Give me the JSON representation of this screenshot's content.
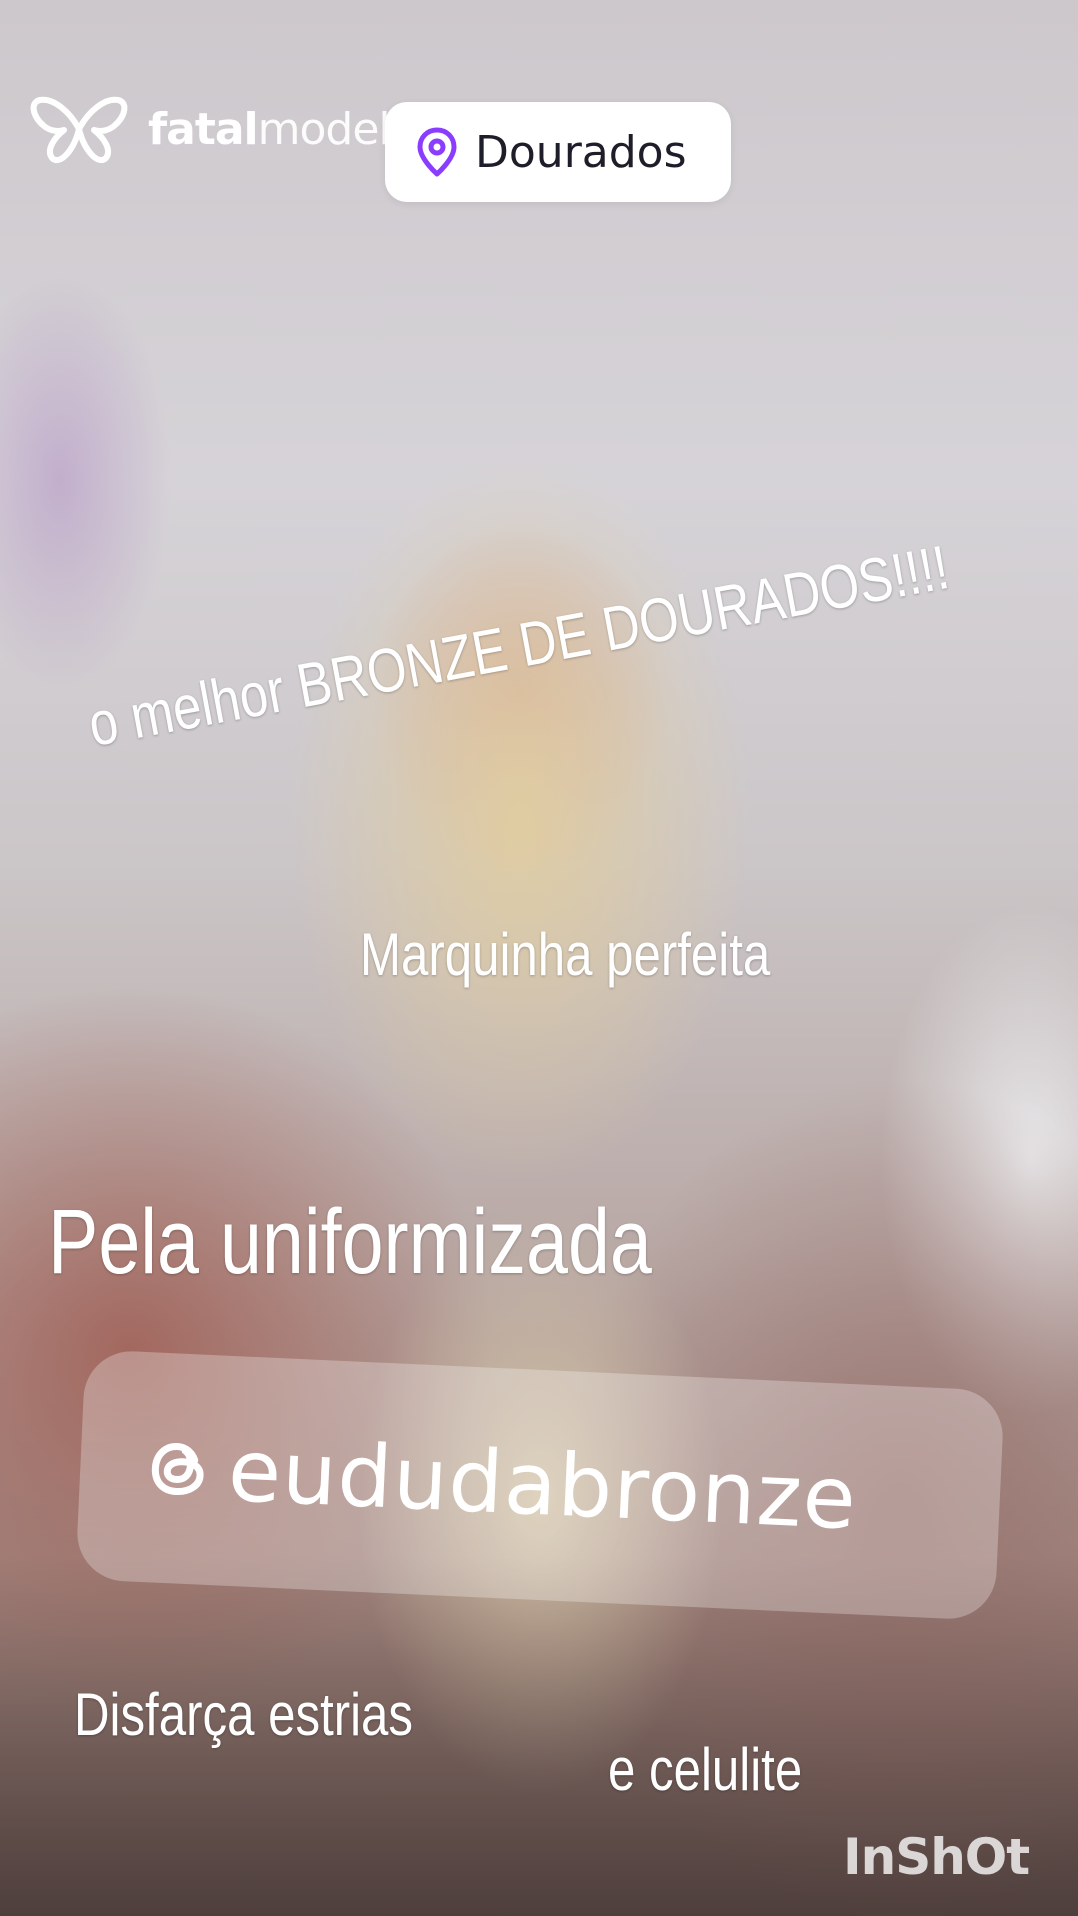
{
  "brand": {
    "name_bold": "fatal",
    "name_light": "model",
    "icon": "butterfly-logo-icon"
  },
  "location": {
    "icon": "map-pin-icon",
    "label": "Dourados",
    "icon_color": "#8b3dff"
  },
  "captions": {
    "headline": "o melhor BRONZE DE DOURADOS!!!!",
    "line1": "Marquinha perfeita",
    "line2": "Pela uniformizada",
    "line3": "Disfarça estrias",
    "line4": "e celulite"
  },
  "social": {
    "icon": "threads-icon",
    "handle": "eududabronze"
  },
  "watermark": "InShOt"
}
